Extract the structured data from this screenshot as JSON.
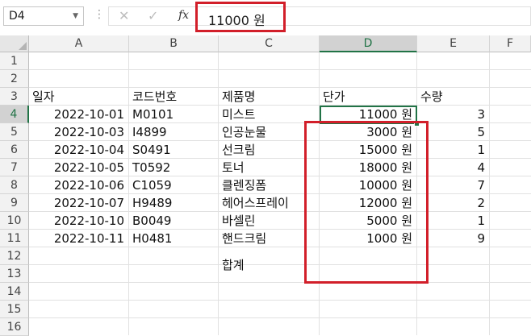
{
  "formula_bar": {
    "name_box": "D4",
    "formula_value": "11000 원",
    "fx_label": "fx",
    "cancel_glyph": "✕",
    "enter_glyph": "✓"
  },
  "columns": [
    "A",
    "B",
    "C",
    "D",
    "E",
    "F"
  ],
  "rows": [
    "1",
    "2",
    "3",
    "4",
    "5",
    "6",
    "7",
    "8",
    "9",
    "10",
    "11",
    "12",
    "13",
    "14",
    "15",
    "16"
  ],
  "headers": {
    "date": "일자",
    "code": "코드번호",
    "product": "제품명",
    "price": "단가",
    "qty": "수량"
  },
  "data_rows": [
    {
      "date": "2022-10-01",
      "code": "M0101",
      "product": "미스트",
      "price": "11000 원",
      "qty": "3"
    },
    {
      "date": "2022-10-03",
      "code": "I4899",
      "product": "인공눈물",
      "price": "3000 원",
      "qty": "5"
    },
    {
      "date": "2022-10-04",
      "code": "S0491",
      "product": "선크림",
      "price": "15000 원",
      "qty": "1"
    },
    {
      "date": "2022-10-05",
      "code": "T0592",
      "product": "토너",
      "price": "18000 원",
      "qty": "4"
    },
    {
      "date": "2022-10-06",
      "code": "C1059",
      "product": "클렌징폼",
      "price": "10000 원",
      "qty": "7"
    },
    {
      "date": "2022-10-07",
      "code": "H9489",
      "product": "헤어스프레이",
      "price": "12000 원",
      "qty": "2"
    },
    {
      "date": "2022-10-10",
      "code": "B0049",
      "product": "바셀린",
      "price": "5000 원",
      "qty": "1"
    },
    {
      "date": "2022-10-11",
      "code": "H0481",
      "product": "핸드크림",
      "price": "1000 원",
      "qty": "9"
    }
  ],
  "total_label": "합계",
  "selected_cell": "D4",
  "colors": {
    "selection": "#217346",
    "highlight_box": "#d21f2a"
  }
}
